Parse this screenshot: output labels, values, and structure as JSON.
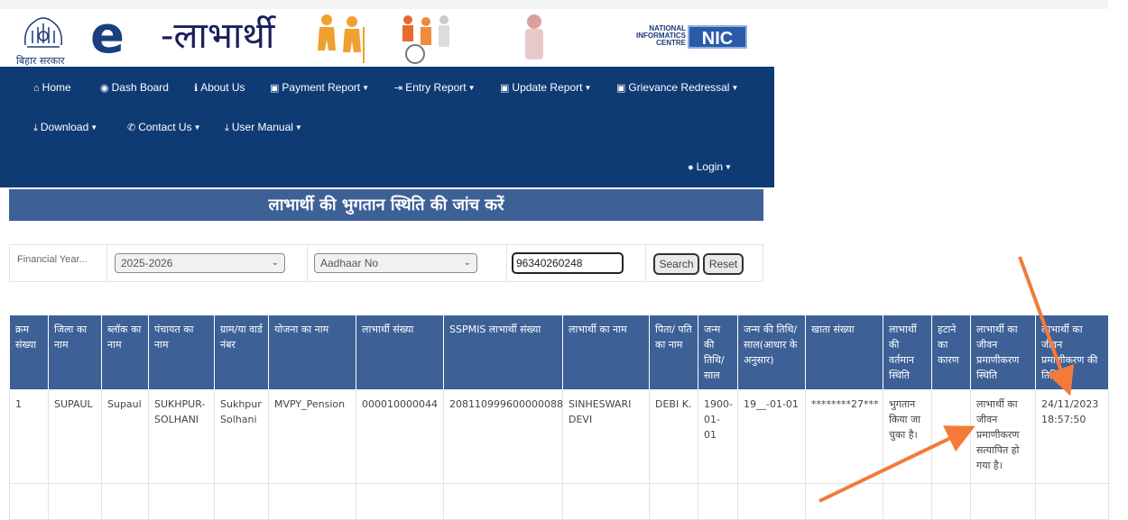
{
  "header": {
    "emblem_caption": "बिहार सरकार",
    "logo_e": "e",
    "logo_text": "-लाभार्थी",
    "nic_text": "NATIONAL INFORMATICS CENTRE",
    "nic_logo": "NIC"
  },
  "nav": {
    "home": "Home",
    "dashboard": "Dash Board",
    "about": "About Us",
    "payment": "Payment Report",
    "entry": "Entry Report",
    "update": "Update Report",
    "grievance": "Grievance Redressal",
    "download": "Download",
    "contact": "Contact Us",
    "manual": "User Manual",
    "login": "Login"
  },
  "page_title": "लाभार्थी की भुगतान स्थिति की जांच करें",
  "form": {
    "fy_label": "Financial Year...",
    "fy_value": "2025-2026",
    "id_type": "Aadhaar No",
    "aadhaar_value": "96340260248",
    "search_label": "Search",
    "reset_label": "Reset"
  },
  "table": {
    "headers": [
      "क्रम संख्या",
      "जिला का नाम",
      "ब्लॉक का नाम",
      "पंचायत का नाम",
      "ग्राम/या वार्ड नंबर",
      "योजना का नाम",
      "लाभार्थी संख्या",
      "SSPMIS लाभार्थी संख्या",
      "लाभार्थी का नाम",
      "पिता/ पति का नाम",
      "जन्म की तिथि/ साल",
      "जन्म की तिथि/ साल(आधार के अनुसार)",
      "खाता संख्या",
      "लाभार्थी की वर्तमान स्थिति",
      "हटाने का कारण",
      "लाभार्थी का जीवन प्रमाणीकरण स्थिति",
      "लाभार्थी का जीवन प्रमाणीकरण की तिथि"
    ],
    "row": [
      "1",
      "SUPAUL",
      "Supaul",
      "SUKHPUR-SOLHANI",
      "Sukhpur Solhani",
      "MVPY_Pension",
      "000010000044",
      "208110999600000088",
      "SINHESWARI DEVI",
      "DEBI K.",
      "1900-01-01",
      "19__-01-01",
      "********27***",
      "भुगतान किया जा चुका है।",
      "",
      "लाभार्थी का जीवन प्रमाणीकरण सत्यापित हो गया है।",
      "24/11/2023 18:57:50"
    ]
  },
  "colors": {
    "navbar": "#0f3b75",
    "title_bar": "#3d6096",
    "table_header": "#3d6096",
    "annotation_arrow": "#f47a3a"
  }
}
